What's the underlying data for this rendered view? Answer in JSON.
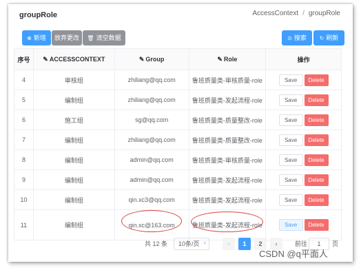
{
  "page": {
    "title": "groupRole",
    "breadcrumb": [
      "AccessContext",
      "groupRole"
    ],
    "breadcrumb_sep": "/"
  },
  "toolbar": {
    "add_label": "新增",
    "discard_label": "放弃更改",
    "clear_label": "清空数据",
    "search_label": "搜索",
    "refresh_label": "刷新"
  },
  "table": {
    "headers": {
      "index": "序号",
      "access_context": "ACCESSCONTEXT",
      "group": "Group",
      "role": "Role",
      "actions": "操作"
    },
    "rows": [
      {
        "index": "4",
        "access_context": "审核组",
        "group": "zhiliang@qq.com",
        "role": "鲁班质量类-审核质量-role"
      },
      {
        "index": "5",
        "access_context": "编制组",
        "group": "zhiliang@qq.com",
        "role": "鲁班质量类-发起流程-role"
      },
      {
        "index": "6",
        "access_context": "施工组",
        "group": "sg@qq.com",
        "role": "鲁班质量类-质量整改-role"
      },
      {
        "index": "7",
        "access_context": "编制组",
        "group": "zhiliang@qq.com",
        "role": "鲁班质量类-质量整改-role"
      },
      {
        "index": "8",
        "access_context": "编制组",
        "group": "admin@qq.com",
        "role": "鲁班质量类-审核质量-role"
      },
      {
        "index": "9",
        "access_context": "编制组",
        "group": "admin@qq.com",
        "role": "鲁班质量类-发起流程-role"
      },
      {
        "index": "10",
        "access_context": "编制组",
        "group": "qin.xc3@qq.com",
        "role": "鲁班质量类-发起流程-role"
      },
      {
        "index": "11",
        "access_context": "编制组",
        "group": "qin.xc@163.com",
        "role": "鲁班质量类-发起流程-role"
      }
    ],
    "save_label": "Save",
    "delete_label": "Delete"
  },
  "pagination": {
    "total_text": "共 12 条",
    "page_size": "10条/页",
    "pages": [
      "1",
      "2"
    ],
    "current_page": "1",
    "goto_label": "前往",
    "goto_value": "1",
    "goto_unit": "页"
  },
  "watermark": "CSDN @q平面人",
  "colors": {
    "primary": "#409eff",
    "info": "#909399",
    "danger": "#f56c6c",
    "annotation": "#d9443f"
  }
}
